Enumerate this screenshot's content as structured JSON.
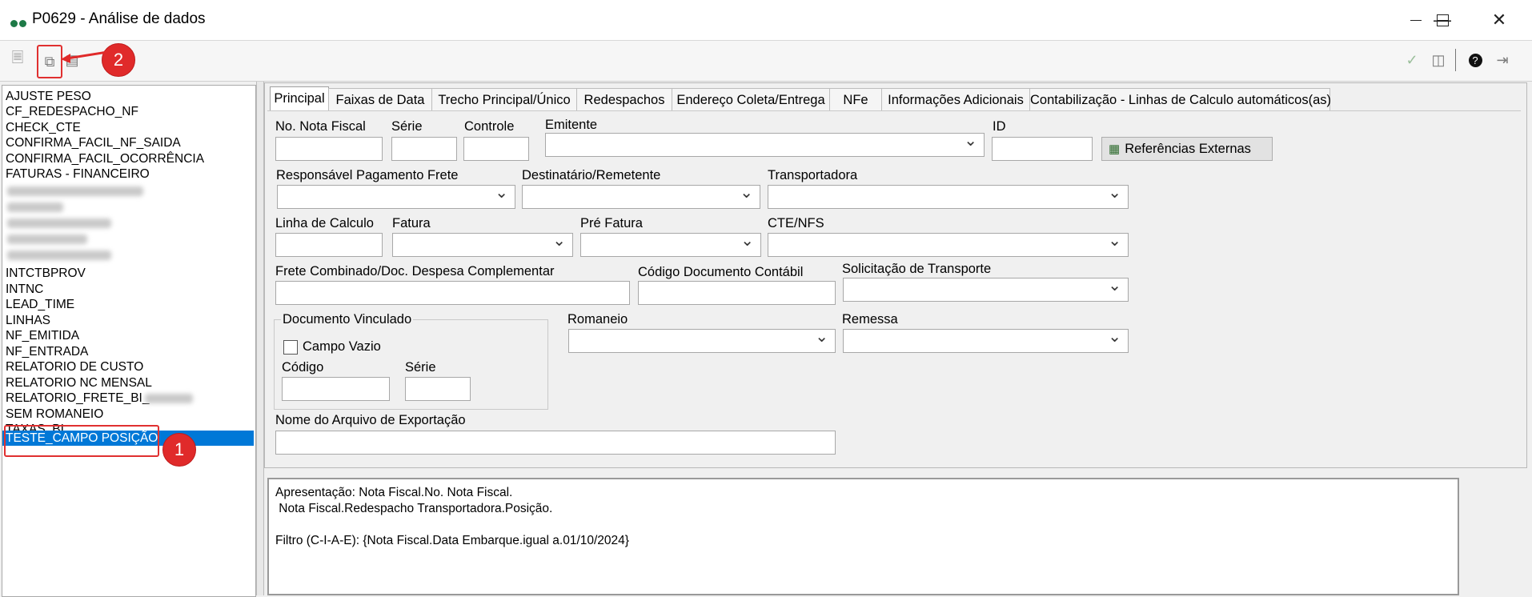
{
  "window": {
    "title": "P0629 - Análise de dados",
    "minimize_icon": "minimize-icon",
    "maximize_icon": "maximize-icon",
    "close_icon": "close-icon"
  },
  "toolbar": {
    "left_icons": [
      "new-document-icon",
      "copy-document-icon",
      "chart-icon"
    ],
    "right_icons": [
      "check-icon",
      "export-icon",
      "help-icon",
      "exit-icon"
    ],
    "annotation_2": "2",
    "annotation_1": "1",
    "annotation_color": "#e02a2a"
  },
  "list": {
    "items": [
      "AJUSTE PESO",
      "CF_REDESPACHO_NF",
      "CHECK_CTE",
      "CONFIRMA_FACIL_NF_SAIDA",
      "CONFIRMA_FACIL_OCORRÊNCIA",
      "FATURAS - FINANCEIRO"
    ],
    "items2": [
      "INTCTBPROV",
      "INTNC",
      "LEAD_TIME",
      "LINHAS",
      "NF_EMITIDA",
      "NF_ENTRADA",
      "RELATORIO DE CUSTO",
      "RELATORIO NC MENSAL",
      "RELATORIO_FRETE_BI_",
      "SEM ROMANEIO",
      "TAXAS_BI"
    ],
    "selected": "TESTE_CAMPO POSIÇÃO",
    "selection_color": "#0078d7"
  },
  "tabs": [
    "Principal",
    "Faixas de Data",
    "Trecho Principal/Único",
    "Redespachos",
    "Endereço Coleta/Entrega",
    "NFe",
    "Informações Adicionais",
    "Contabilização - Linhas de Calculo automáticos(as)"
  ],
  "form": {
    "nota_fiscal": "No. Nota Fiscal",
    "serie": "Série",
    "controle": "Controle",
    "emitente": "Emitente",
    "id": "ID",
    "referencias": "Referências Externas",
    "resp_pagamento": "Responsável Pagamento Frete",
    "destinatario": "Destinatário/Remetente",
    "transportadora": "Transportadora",
    "linha_calculo": "Linha de Calculo",
    "fatura": "Fatura",
    "pre_fatura": "Pré Fatura",
    "cte_nfs": "CTE/NFS",
    "frete_combinado": "Frete Combinado/Doc. Despesa Complementar",
    "codigo_contabil": "Código Documento Contábil",
    "solicitacao": "Solicitação de Transporte",
    "doc_vinculado": "Documento Vinculado",
    "campo_vazio": "Campo Vazio",
    "codigo": "Código",
    "serie2": "Série",
    "romaneio": "Romaneio",
    "remessa": "Remessa",
    "nome_arquivo": "Nome do Arquivo de Exportação"
  },
  "summary": {
    "line1": "Apresentação: Nota Fiscal.No. Nota Fiscal.",
    "line2": " Nota Fiscal.Redespacho Transportadora.Posição.",
    "line3": "Filtro (C-I-A-E): {Nota Fiscal.Data Embarque.igual a.01/10/2024}"
  }
}
